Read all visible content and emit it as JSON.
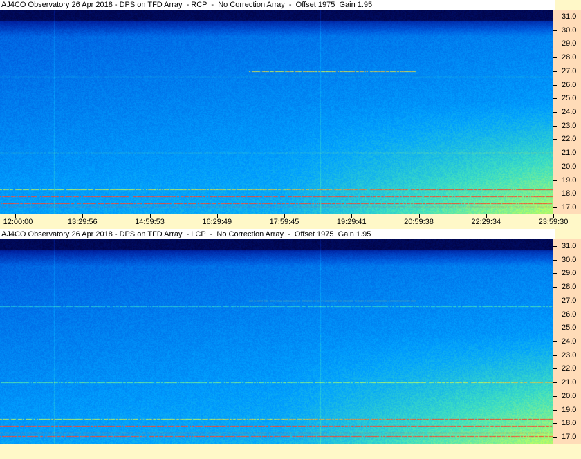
{
  "panels": [
    {
      "title": "AJ4CO Observatory 26 Apr 2018 - DPS on TFD Array  - RCP  -  No Correction Array  -  Offset 1975  Gain 1.95",
      "polarization": "RCP"
    },
    {
      "title": "AJ4CO Observatory 26 Apr 2018 - DPS on TFD Array  - LCP  -  No Correction Array  -  Offset 1975  Gain 1.95",
      "polarization": "LCP"
    }
  ],
  "time_axis": {
    "labels": [
      "12:00:00",
      "13:29:56",
      "14:59:53",
      "16:29:49",
      "17:59:45",
      "19:29:41",
      "20:59:38",
      "22:29:34",
      "23:59:30"
    ]
  },
  "chart_data": [
    {
      "type": "heatmap",
      "title": "AJ4CO Observatory 26 Apr 2018 - DPS on TFD Array  - RCP  -  No Correction Array  -  Offset 1975  Gain 1.95",
      "x_ticks": [
        "12:00:00",
        "13:29:56",
        "14:59:53",
        "16:29:49",
        "17:59:45",
        "19:29:41",
        "20:59:38",
        "22:29:34",
        "23:59:30"
      ],
      "y_ticks": [
        "31.0",
        "30.0",
        "29.0",
        "28.0",
        "27.0",
        "26.0",
        "25.0",
        "24.0",
        "23.0",
        "22.0",
        "21.0",
        "20.0",
        "19.0",
        "18.0",
        "17.0"
      ],
      "ylim": [
        16.5,
        31.5
      ],
      "colormap": [
        "#00003a",
        "#0020a0",
        "#0060e0",
        "#00a0ff",
        "#40e0c0",
        "#c0ff60",
        "#ff4020"
      ]
    },
    {
      "type": "heatmap",
      "title": "AJ4CO Observatory 26 Apr 2018 - DPS on TFD Array  - LCP  -  No Correction Array  -  Offset 1975  Gain 1.95",
      "x_ticks": [
        "12:00:00",
        "13:29:56",
        "14:59:53",
        "16:29:49",
        "17:59:45",
        "19:29:41",
        "20:59:38",
        "22:29:34",
        "23:59:30"
      ],
      "y_ticks": [
        "31.0",
        "30.0",
        "29.0",
        "28.0",
        "27.0",
        "26.0",
        "25.0",
        "24.0",
        "23.0",
        "22.0",
        "21.0",
        "20.0",
        "19.0",
        "18.0",
        "17.0"
      ],
      "ylim": [
        16.5,
        31.5
      ],
      "colormap": [
        "#00003a",
        "#0020a0",
        "#0060e0",
        "#00a0ff",
        "#40e0c0",
        "#c0ff60",
        "#ff4020"
      ]
    }
  ]
}
